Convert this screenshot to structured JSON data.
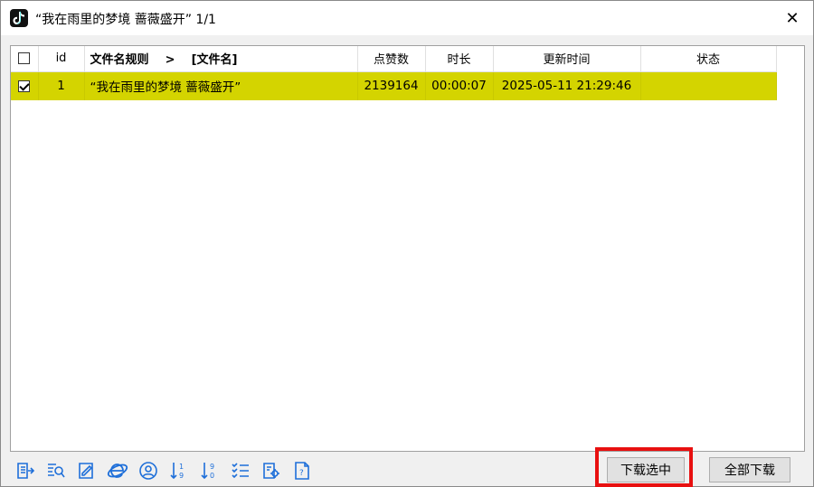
{
  "window": {
    "title": "“我在雨里的梦境 蔷薇盛开” 1/1",
    "app_icon": "tiktok-icon",
    "close_glyph": "✕"
  },
  "table": {
    "columns": [
      "",
      "id",
      "文件名规则    >    [文件名]",
      "点赞数",
      "时长",
      "更新时间",
      "状态"
    ],
    "rows": [
      {
        "checked": true,
        "id": "1",
        "filename": "“我在雨里的梦境 蔷薇盛开”",
        "likes": "2139164",
        "duration": "00:00:07",
        "updated": "2025-05-11 21:29:46",
        "status": ""
      }
    ],
    "row_highlight_color": "#d4d400"
  },
  "toolbar": {
    "icons": [
      "export-icon",
      "search-list-icon",
      "edit-icon",
      "browser-icon",
      "user-icon",
      "sort-ascending-icon",
      "sort-descending-icon",
      "list-icon",
      "settings-icon",
      "help-icon"
    ],
    "icon_color": "#1e6fd9"
  },
  "buttons": {
    "download_selected": "下载选中",
    "download_all": "全部下载"
  },
  "highlight_color": "#e81010"
}
